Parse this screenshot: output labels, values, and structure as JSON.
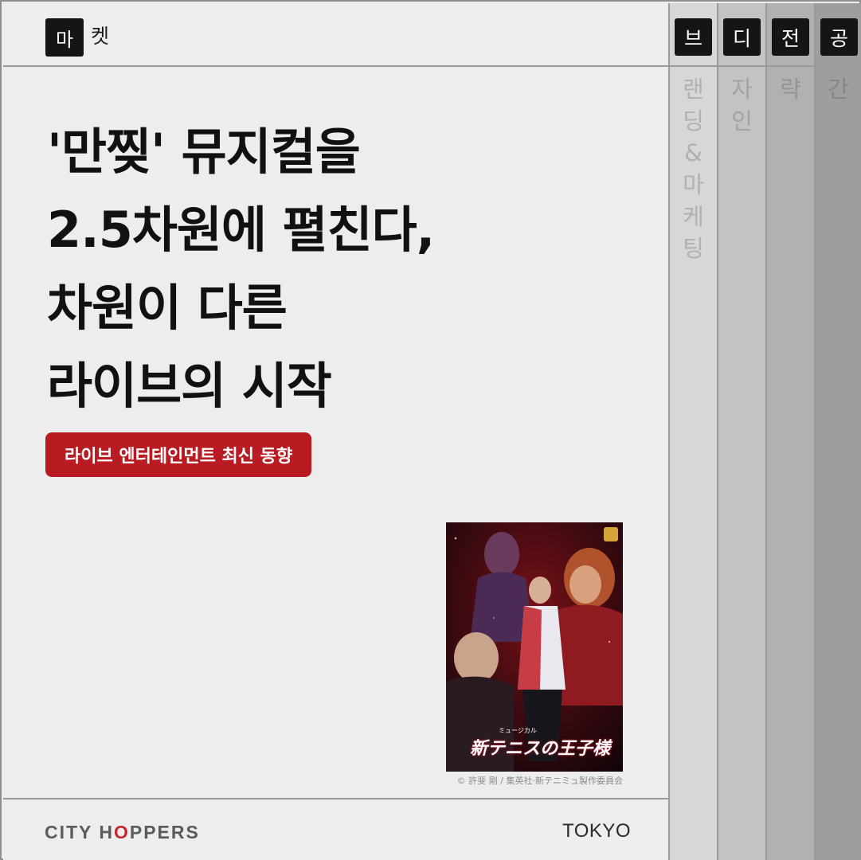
{
  "header": {
    "tag_first": "마",
    "tag_rest": "켓"
  },
  "headline": {
    "lines": [
      "'만찢' 뮤지컬을",
      "2.5차원에 펼친다,",
      "차원이 다른",
      "라이브의 시작"
    ]
  },
  "pill": {
    "label": "라이브 엔터테인먼트 최신 동향",
    "color": "#b81c22"
  },
  "poster": {
    "title_jp": "新テニスの王子様",
    "subtitle_jp": "ミュージカル",
    "credit": "© 許斐 剛 / 集英社·新テニミュ製作委員会"
  },
  "footer": {
    "brand_left": "CITY H",
    "brand_mark": "O",
    "brand_right": "PPERS",
    "city": "TOKYO"
  },
  "columns": [
    {
      "head": "브",
      "rest": [
        "랜",
        "딩",
        "&",
        "마",
        "케",
        "팅"
      ]
    },
    {
      "head": "디",
      "rest": [
        "자",
        "인"
      ]
    },
    {
      "head": "전",
      "rest": [
        "략"
      ]
    },
    {
      "head": "공",
      "rest": [
        "간"
      ]
    }
  ]
}
